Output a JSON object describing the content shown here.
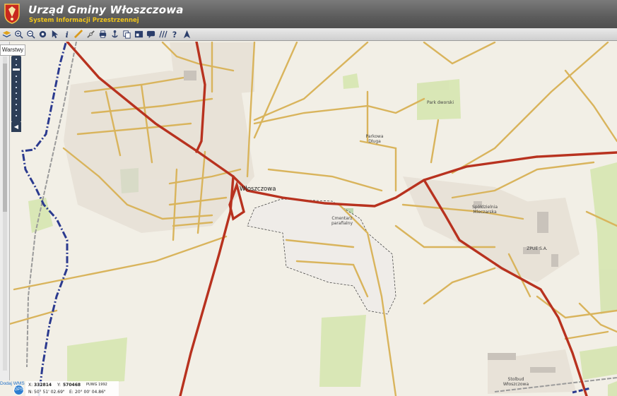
{
  "app": {
    "title": "Urząd Gminy Włoszczowa",
    "subtitle": "System Informacji Przestrzennej"
  },
  "toolbar": {
    "tools": [
      {
        "name": "layers-icon"
      },
      {
        "name": "zoom-in-icon"
      },
      {
        "name": "zoom-out-icon"
      },
      {
        "name": "zoom-extent-icon"
      },
      {
        "name": "select-arrow-icon"
      },
      {
        "name": "info-icon"
      },
      {
        "name": "measure-icon"
      },
      {
        "name": "link-icon"
      },
      {
        "name": "print-icon"
      },
      {
        "name": "anchor-icon"
      },
      {
        "name": "copy-icon"
      },
      {
        "name": "layout-icon"
      },
      {
        "name": "chat-icon"
      },
      {
        "name": "hatch-icon"
      },
      {
        "name": "help-icon"
      },
      {
        "name": "north-icon"
      }
    ]
  },
  "sidebar": {
    "tab_label": "Warstwy"
  },
  "map": {
    "town_label": "Włoszczowa",
    "labels": {
      "park": "Park dworski",
      "parkowa": "Parkowa\nDługa",
      "cmentarz": "Cmentarz\nparafialny",
      "spoldzielnia": "Spółdzielnia\nMleczarska",
      "zpue": "ZPUE S.A.",
      "stolbud": "Stolbud\nWłoszczowa"
    },
    "colors": {
      "main_road": "#b8321f",
      "secondary_road": "#d9b45c",
      "boundary": "#2b3a8f",
      "greenery": "#d3e4ac"
    }
  },
  "footer": {
    "wms_link": "Dodaj WMS",
    "gps_label": "GPS",
    "x_label": "X:",
    "x_value": "332814",
    "y_label": "Y:",
    "y_value": "570468",
    "crs": "PUWG 1992",
    "n_label": "N:",
    "n_value": "50° 51' 02.69\"",
    "e_label": "E:",
    "e_value": "20° 00' 04.86\""
  }
}
